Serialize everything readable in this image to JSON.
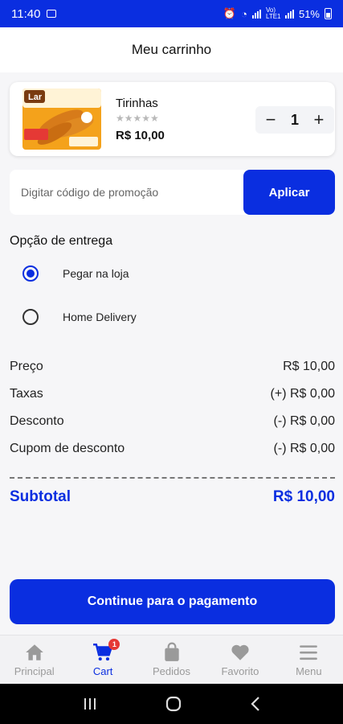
{
  "status_bar": {
    "time": "11:40",
    "network_label": "Vo) LTE1",
    "battery": "51%"
  },
  "header": {
    "title": "Meu carrinho"
  },
  "cart_item": {
    "name": "Tirinhas",
    "brand_text": "Lar",
    "rating_stars": "★★★★★",
    "price": "R$ 10,00",
    "quantity": "1",
    "minus_label": "−",
    "plus_label": "+"
  },
  "promo": {
    "placeholder": "Digitar código de promoção",
    "value": "",
    "apply_label": "Aplicar"
  },
  "delivery": {
    "title": "Opção de entrega",
    "options": [
      {
        "label": "Pegar na loja",
        "selected": true
      },
      {
        "label": "Home Delivery",
        "selected": false
      }
    ]
  },
  "summary": {
    "rows": [
      {
        "label": "Preço",
        "value": "R$ 10,00"
      },
      {
        "label": "Taxas",
        "value": "(+) R$ 0,00"
      },
      {
        "label": "Desconto",
        "value": "(-) R$ 0,00"
      },
      {
        "label": "Cupom de desconto",
        "value": "(-) R$ 0,00"
      }
    ],
    "subtotal_label": "Subtotal",
    "subtotal_value": "R$ 10,00"
  },
  "continue_label": "Continue para o pagamento",
  "bottom_nav": {
    "items": [
      {
        "label": "Principal",
        "icon": "home-icon",
        "active": false
      },
      {
        "label": "Cart",
        "icon": "cart-icon",
        "active": true,
        "badge": "1"
      },
      {
        "label": "Pedidos",
        "icon": "bag-icon",
        "active": false
      },
      {
        "label": "Favorito",
        "icon": "heart-icon",
        "active": false
      },
      {
        "label": "Menu",
        "icon": "menu-icon",
        "active": false
      }
    ]
  },
  "colors": {
    "primary": "#0a2ee0",
    "background": "#f6f6f8",
    "badge": "#e53935"
  }
}
